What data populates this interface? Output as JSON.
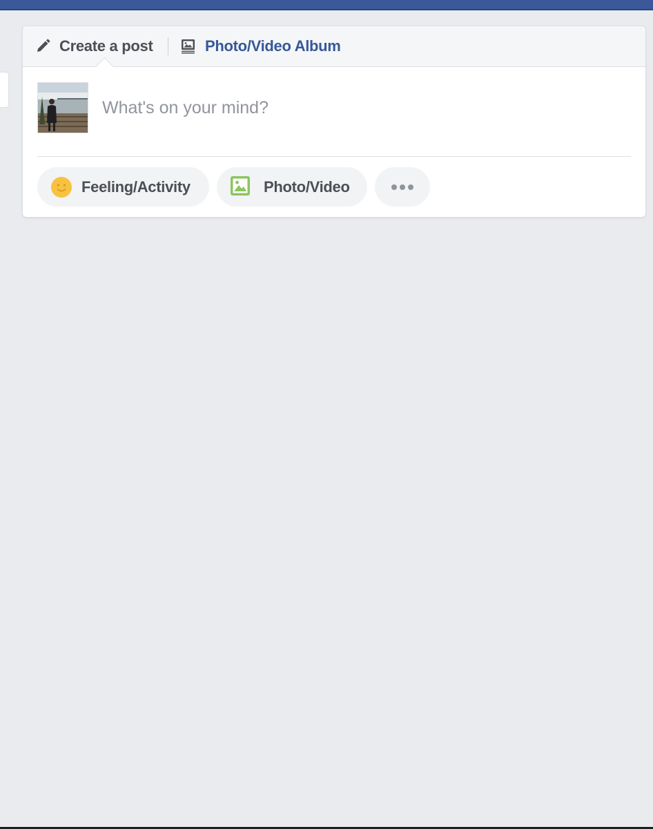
{
  "composer": {
    "tabs": {
      "create_post_label": "Create a post",
      "photo_album_label": "Photo/Video Album"
    },
    "input": {
      "placeholder": "What's on your mind?",
      "value": ""
    },
    "actions": {
      "feeling_label": "Feeling/Activity",
      "photo_video_label": "Photo/Video",
      "more_label": "..."
    },
    "icons": {
      "create_post": "pencil-icon",
      "photo_album": "photo-album-icon",
      "feeling": "smiley-face-icon",
      "photo_video": "photo-icon",
      "more": "more-dots-icon"
    }
  },
  "colors": {
    "brand_blue": "#3b5998",
    "link_blue": "#365899",
    "page_background": "#e9ebee",
    "smiley_yellow": "#f7c23f",
    "photo_green": "#8cc560"
  }
}
